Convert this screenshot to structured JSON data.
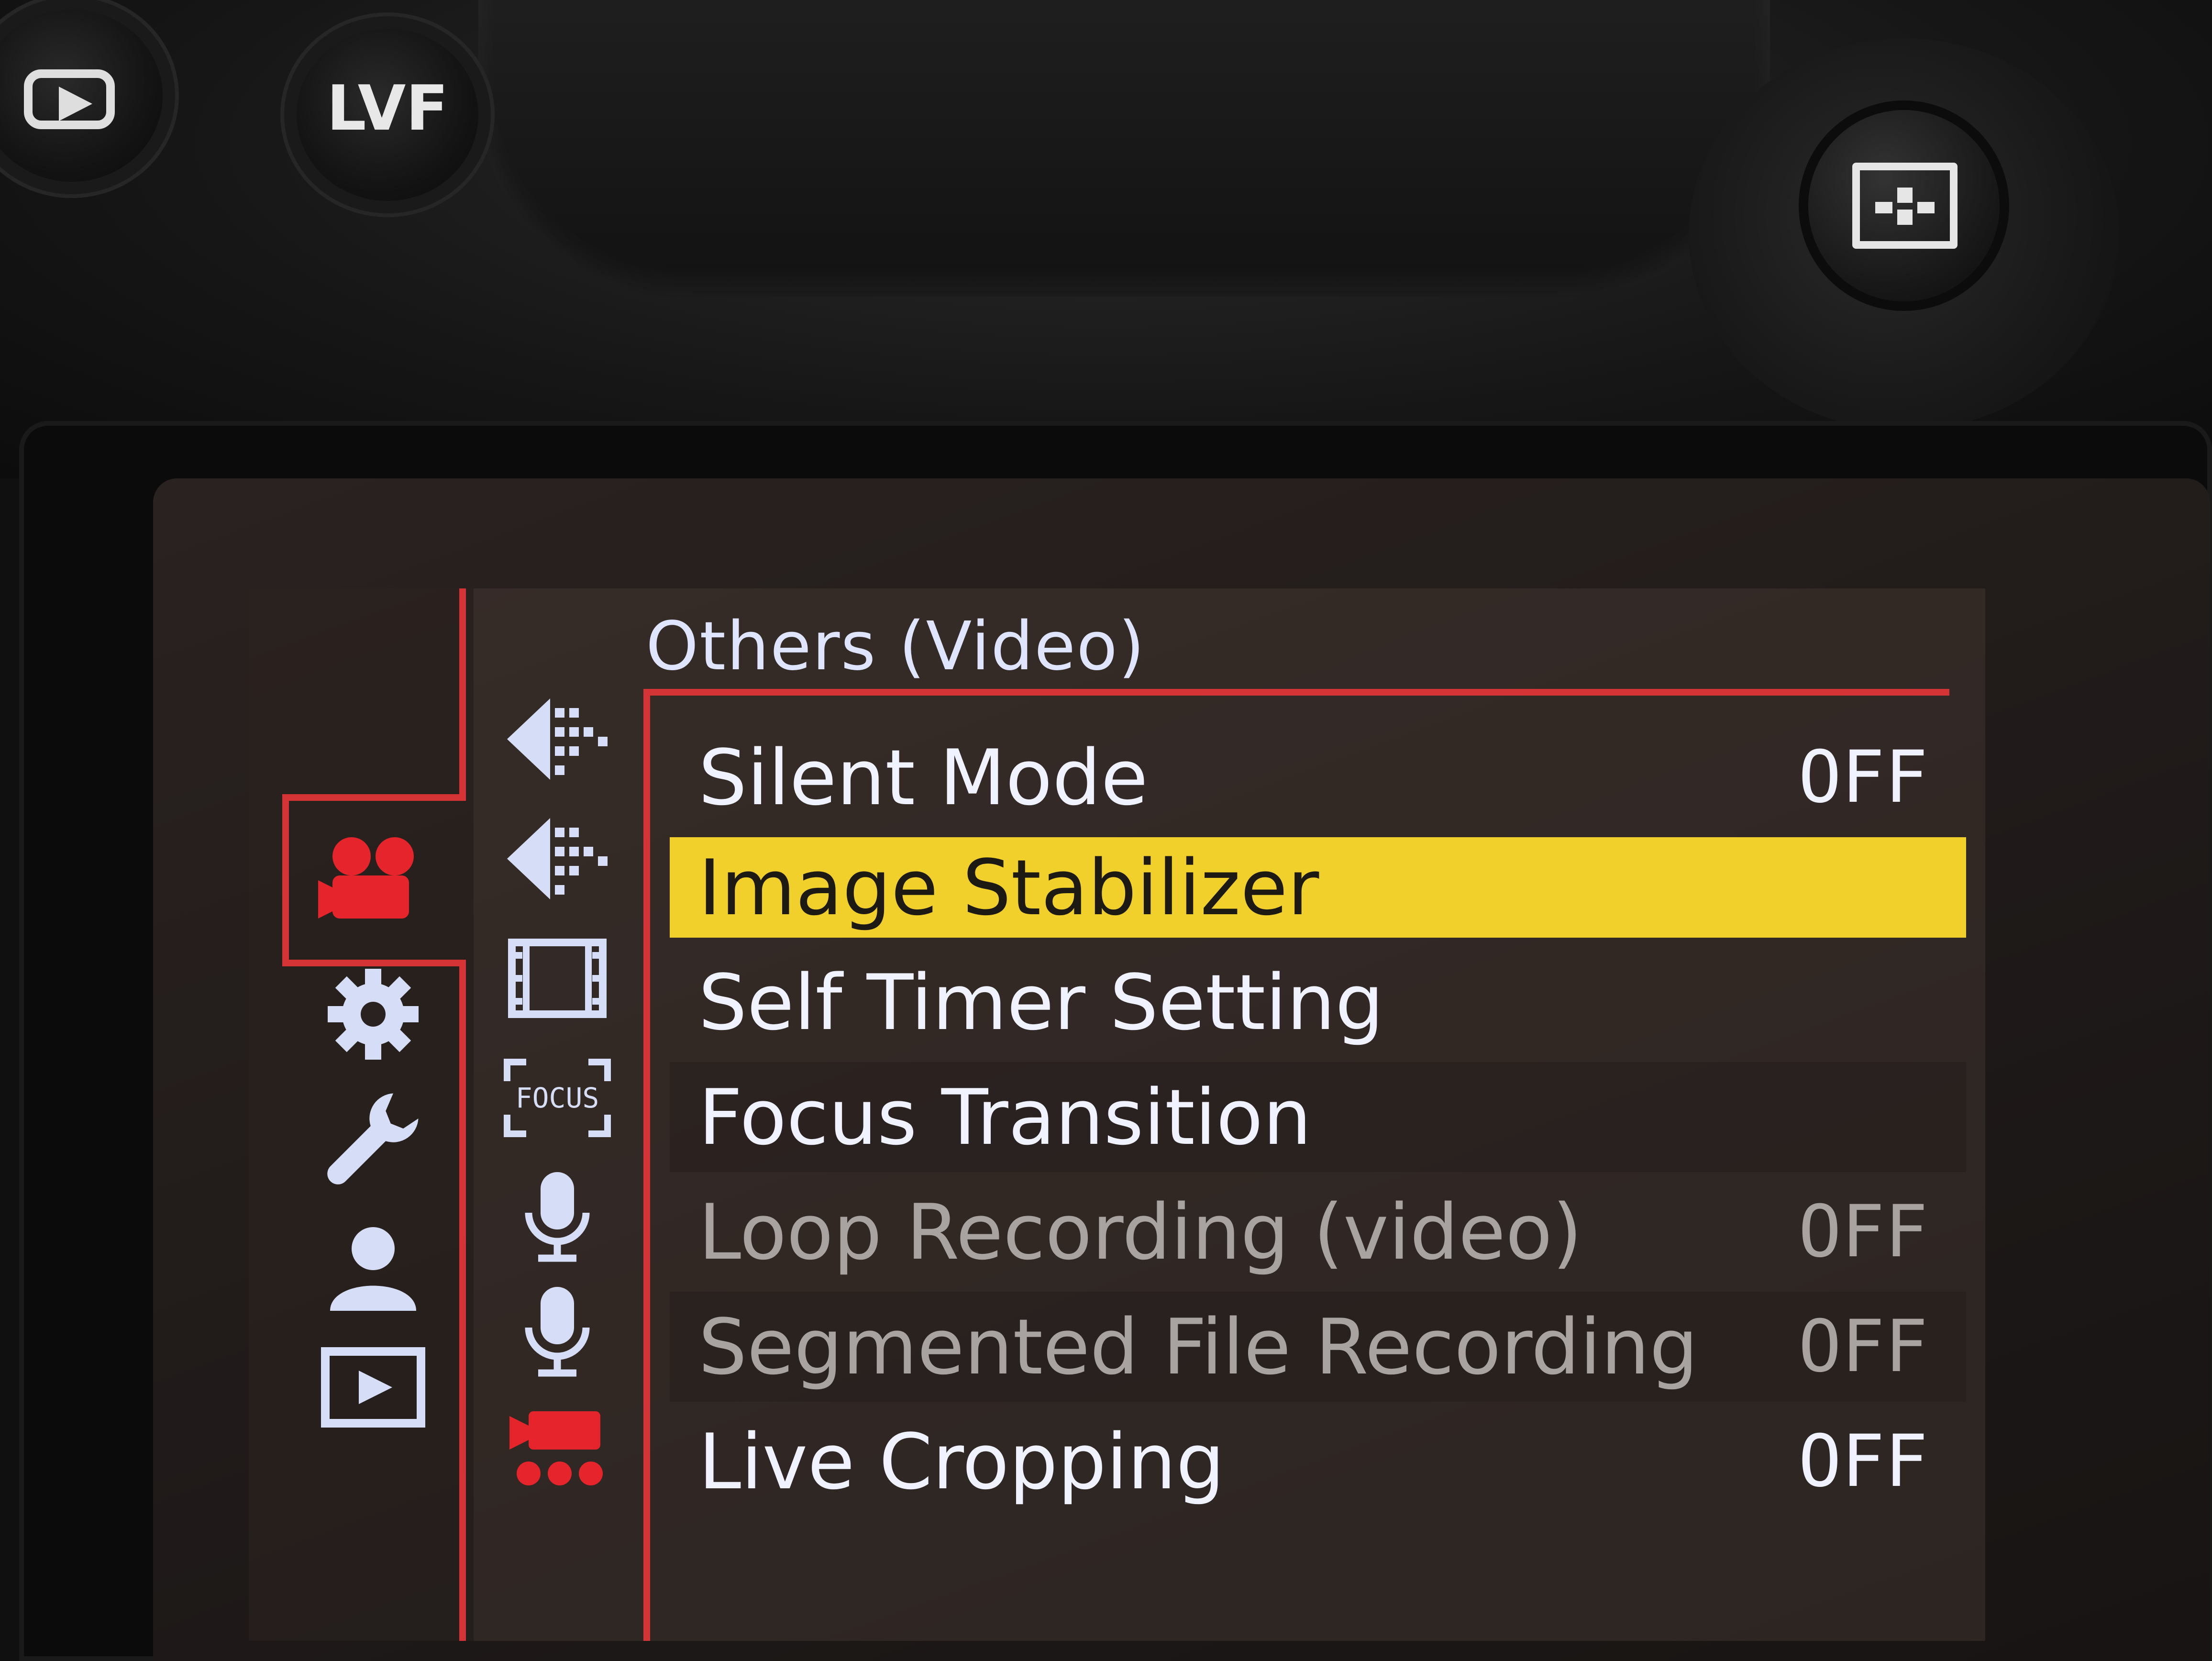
{
  "camera": {
    "buttons": [
      {
        "name": "playback",
        "label": ""
      },
      {
        "name": "lvf",
        "label": "LVF"
      }
    ]
  },
  "menu": {
    "heading": "Others (Video)",
    "categories": [
      {
        "icon": "video-camera-icon",
        "active": true
      },
      {
        "icon": "gear-icon",
        "active": false
      },
      {
        "icon": "wrench-icon",
        "active": false
      },
      {
        "icon": "person-icon",
        "active": false
      },
      {
        "icon": "playback-icon",
        "active": false
      }
    ],
    "subtabs": [
      {
        "icon": "image-quality-icon-1",
        "label": ""
      },
      {
        "icon": "image-quality-icon-2",
        "label": ""
      },
      {
        "icon": "film-strip-icon",
        "label": ""
      },
      {
        "icon": "focus-icon",
        "label": "FOCUS"
      },
      {
        "icon": "microphone-icon-1",
        "label": ""
      },
      {
        "icon": "microphone-icon-2",
        "label": ""
      },
      {
        "icon": "others-video-icon",
        "label": "",
        "active": true
      }
    ],
    "items": [
      {
        "label": "Silent Mode",
        "value": "OFF",
        "state": "normal"
      },
      {
        "label": "Image Stabilizer",
        "value": "",
        "state": "selected"
      },
      {
        "label": "Self Timer Setting",
        "value": "",
        "state": "normal"
      },
      {
        "label": "Focus Transition",
        "value": "",
        "state": "normal"
      },
      {
        "label": "Loop Recording (video)",
        "value": "OFF",
        "state": "disabled"
      },
      {
        "label": "Segmented File Recording",
        "value": "OFF",
        "state": "disabled"
      },
      {
        "label": "Live Cropping",
        "value": "OFF",
        "state": "normal"
      }
    ]
  },
  "colors": {
    "accent_red": "#d43435",
    "highlight_yellow": "#f2d02c",
    "text_blue_white": "#f0f3ff",
    "disabled_gray": "#a8a3a0"
  }
}
